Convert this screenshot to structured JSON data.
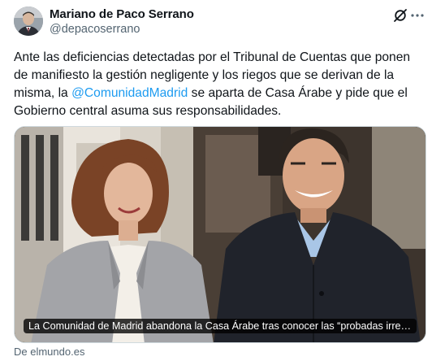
{
  "author": {
    "name": "Mariano de Paco Serrano",
    "handle": "@depacoserrano"
  },
  "tweet": {
    "text_before": "Ante las deficiencias detectadas por el Tribunal de Cuentas que ponen de manifiesto la gestión negligente y los riegos que se derivan de la misma, la ",
    "mention": "@ComunidadMadrid",
    "text_after": " se aparta de Casa Árabe y pide que el Gobierno central asuma sus responsabilidades."
  },
  "card": {
    "caption": "La Comunidad de Madrid abandona la Casa Árabe tras conocer las “probadas irregular...",
    "source": "De elmundo.es"
  },
  "icons": {
    "grok": "grok-icon",
    "more": "more-icon",
    "avatar": "avatar"
  },
  "colors": {
    "text": "#0f1419",
    "secondary": "#536471",
    "link": "#1d9bf0",
    "border": "#cfd9de"
  }
}
